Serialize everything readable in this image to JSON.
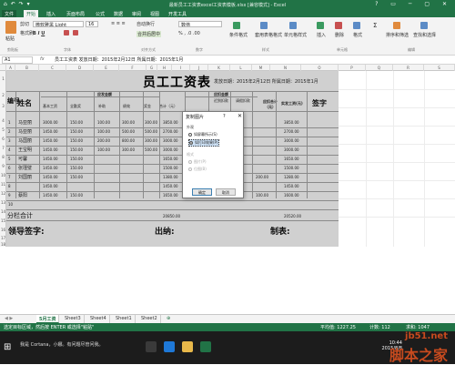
{
  "window": {
    "title": "最新员工工资表excel工资表模板.xlsx [兼容模式] - Excel",
    "quick_access": "⌂ ↶ ↷ ▾",
    "controls": "? ▭ ─ ▢ ✕"
  },
  "ribbon_tabs": [
    "文件",
    "开始",
    "插入",
    "页面布局",
    "公式",
    "数据",
    "审阅",
    "视图",
    "开发工具"
  ],
  "ribbon": {
    "font_name": "微软雅黑 Light",
    "font_size": "16",
    "number_format": "数值",
    "paste": "粘贴",
    "cut": "剪切",
    "format_painter": "格式刷",
    "wrap": "自动换行",
    "merge": "合并后居中",
    "conditional": "条件格式",
    "table_format": "套用表格格式",
    "cell_styles": "单元格样式",
    "insert": "插入",
    "delete": "删除",
    "format": "格式",
    "sort_filter": "排序和筛选",
    "find_select": "查找和选择",
    "groups": [
      "剪贴板",
      "字体",
      "对齐方式",
      "数字",
      "样式",
      "单元格",
      "编辑"
    ]
  },
  "formula_bar": {
    "name_box": "A1",
    "fx": "fx",
    "value": "员工工资表   发放日期：2015年2月12日  所属日期：2015年1月"
  },
  "columns": [
    "A",
    "B",
    "C",
    "D",
    "E",
    "F",
    "G",
    "H",
    "I",
    "J",
    "K",
    "L",
    "M",
    "N",
    "O",
    "P",
    "Q",
    "R",
    "S"
  ],
  "rows": [
    "1",
    "2",
    "3",
    "4",
    "5",
    "6",
    "7",
    "8",
    "9",
    "10",
    "11",
    "12",
    "13",
    "14",
    "15",
    "16",
    "17",
    "18",
    "19"
  ],
  "sheet": {
    "title": "员工工资表",
    "meta": "发放日期：2015年2月12日  所属日期：2015年1月",
    "h_no": "编号",
    "h_name": "姓名",
    "h_payable": "应发金额",
    "h_deduct": "应扣金额",
    "h_deduct_total": "应扣合计（元）",
    "h_actual": "实发工资(元)",
    "h_sign": "签字",
    "sub_headers": [
      "基本工资",
      "全勤奖",
      "补助",
      "绩效",
      "奖金",
      "合计（元）",
      "迟到扣款",
      "请假扣款"
    ],
    "employees": [
      {
        "no": "1",
        "name": "马亚丽",
        "vals": [
          "3000.00",
          "150.00",
          "100.00",
          "300.00",
          "300.00",
          "3850.00"
        ],
        "actual": "3850.00"
      },
      {
        "no": "2",
        "name": "马亚丽",
        "vals": [
          "1450.00",
          "150.00",
          "100.00",
          "500.00",
          "500.00",
          "2700.00"
        ],
        "actual": "2700.00"
      },
      {
        "no": "3",
        "name": "马国丽",
        "vals": [
          "1450.00",
          "150.00",
          "200.00",
          "800.00",
          "300.00",
          "3000.00"
        ],
        "actual": "3000.00"
      },
      {
        "no": "4",
        "name": "王宝明",
        "vals": [
          "1450.00",
          "150.00",
          "100.00",
          "300.00",
          "500.00",
          "3000.00"
        ],
        "actual": "3000.00"
      },
      {
        "no": "5",
        "name": "可馨",
        "vals": [
          "1450.00",
          "150.00",
          "",
          "",
          "",
          "1650.00"
        ],
        "actual": "1650.00"
      },
      {
        "no": "6",
        "name": "张瑾璧",
        "vals": [
          "1450.00",
          "150.00",
          "",
          "",
          "",
          "1500.00"
        ],
        "actual": "1500.00"
      },
      {
        "no": "7",
        "name": "刘国丽",
        "vals": [
          "1450.00",
          "150.00",
          "",
          "",
          "",
          "1380.00"
        ],
        "actual": "1280.00"
      },
      {
        "no": "8",
        "name": "",
        "vals": [
          "1450.00",
          "",
          "",
          "",
          "",
          "1450.00"
        ],
        "actual": "1450.00"
      },
      {
        "no": "9",
        "name": "蔡阳",
        "vals": [
          "1450.00",
          "150.00",
          "",
          "",
          "",
          "1650.00"
        ],
        "actual": "1600.00"
      },
      {
        "no": "10",
        "name": "",
        "vals": [
          "",
          "",
          "",
          "",
          "",
          ""
        ],
        "actual": ""
      }
    ],
    "deduct_shown": [
      "200.00",
      "100.00"
    ],
    "subtotal_label": "分栏合计",
    "subtotal_value": "20850.00",
    "actual_total": "20520.00",
    "leader": "领导签字:",
    "cashier": "出纳:",
    "maker": "制表:"
  },
  "dialog": {
    "title": "复制图片",
    "help": "?",
    "close": "✕",
    "appearance_label": "外观",
    "opt_screen": "如屏幕所示(S)",
    "opt_print": "如打印效果(P)",
    "format_label": "格式",
    "opt_picture": "图片(P)",
    "opt_bitmap": "位图(B)",
    "ok": "确定",
    "cancel": "取消"
  },
  "sheet_tabs": [
    "5月工资",
    "Sheet3",
    "Sheet4",
    "Sheet1",
    "Sheet2",
    "⊕"
  ],
  "statusbar": {
    "left": "选定目标区域，然后按 ENTER 或选择\"粘贴\"",
    "avg": "平均值: 1227.25",
    "count": "计数: 112",
    "sum": "求和: 1047"
  },
  "taskbar": {
    "cortana": "我是 Cortana，小娜。有问题尽管问我。",
    "time": "10:44",
    "date": "2015/8/8"
  },
  "watermark": {
    "site": "jb51.net",
    "brand": "脚本之家"
  }
}
